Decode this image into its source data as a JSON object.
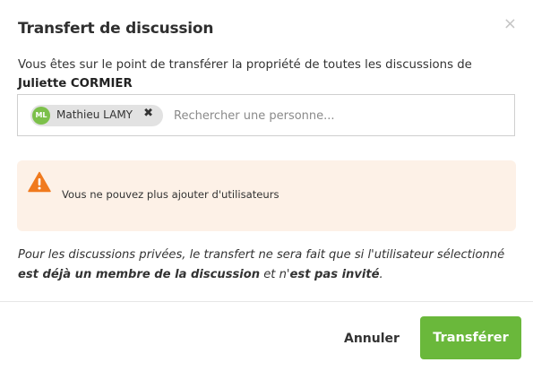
{
  "dialog": {
    "title": "Transfert de discussion",
    "close_glyph": "×"
  },
  "intro": {
    "text_before": "Vous êtes sur le point de transférer la propriété de toutes les discussions de ",
    "user_name": "Juliette CORMIER"
  },
  "picker": {
    "chip": {
      "initials": "ML",
      "name": "Mathieu LAMY",
      "remove_glyph": "✖",
      "avatar_color": "#7cc04a"
    },
    "placeholder": "Rechercher une personne..."
  },
  "alert": {
    "icon": "warning-triangle-icon",
    "icon_color": "#f07a1e",
    "message": "Vous ne pouvez plus ajouter d'utilisateurs",
    "background": "#fdf1e7"
  },
  "note": {
    "part1": "Pour les discussions privées, le transfert ne sera fait que si l'utilisateur sélectionné ",
    "bold1": "est déjà un membre de la discussion",
    "part2": " et n'",
    "bold2": "est pas invité",
    "part3": "."
  },
  "footer": {
    "cancel_label": "Annuler",
    "submit_label": "Transférer",
    "submit_color": "#6ab83b"
  }
}
